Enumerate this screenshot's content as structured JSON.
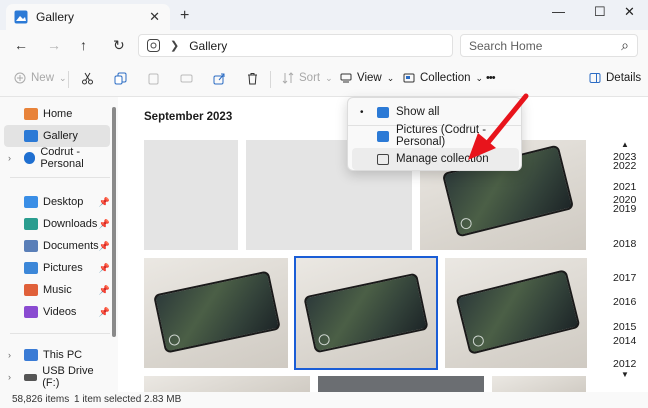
{
  "window": {
    "tab_title": "Gallery",
    "tab_close": "✕",
    "new_tab": "+",
    "minimize": "—",
    "maximize": "☐",
    "close": "✕"
  },
  "nav": {
    "back": "←",
    "forward": "→",
    "up": "↑",
    "refresh": "↻",
    "breadcrumb_sep": "❯",
    "breadcrumb": "Gallery",
    "search_placeholder": "Search Home",
    "search_icon": "⌕"
  },
  "toolbar": {
    "new_label": "New",
    "sort_label": "Sort",
    "view_label": "View",
    "collection_label": "Collection",
    "more": "•••",
    "details_label": "Details",
    "caret": "⌄"
  },
  "sidebar": {
    "items": [
      {
        "label": "Home",
        "icon": "home-icon",
        "color": "#e8833a"
      },
      {
        "label": "Gallery",
        "icon": "gallery-icon",
        "color": "#2c7ad6"
      },
      {
        "label": "Codrut - Personal",
        "icon": "onedrive-icon",
        "color": "#1f6fd0"
      },
      {
        "label": "Desktop",
        "icon": "desktop-icon",
        "color": "#3a8ee6"
      },
      {
        "label": "Downloads",
        "icon": "downloads-icon",
        "color": "#2a9d8f"
      },
      {
        "label": "Documents",
        "icon": "documents-icon",
        "color": "#5a7fb8"
      },
      {
        "label": "Pictures",
        "icon": "pictures-icon",
        "color": "#3c87d8"
      },
      {
        "label": "Music",
        "icon": "music-icon",
        "color": "#e0603a"
      },
      {
        "label": "Videos",
        "icon": "videos-icon",
        "color": "#8a4bd1"
      },
      {
        "label": "This PC",
        "icon": "pc-icon",
        "color": "#3a7bd5"
      },
      {
        "label": "USB Drive (F:)",
        "icon": "usb-drive-icon",
        "color": "#555555"
      }
    ],
    "pin": "📌",
    "chevron": "›"
  },
  "main": {
    "month_heading": "September 2023"
  },
  "menu": {
    "items": [
      {
        "label": "Show all",
        "bullet": "•"
      },
      {
        "label": "Pictures (Codrut - Personal)"
      },
      {
        "label": "Manage collection"
      }
    ]
  },
  "timeline": {
    "up": "▲",
    "down": "▼",
    "years": [
      "2023",
      "2022",
      "2021",
      "2020",
      "2019",
      "2018",
      "2017",
      "2016",
      "2015",
      "2014",
      "2012"
    ]
  },
  "status": {
    "item_count": "58,826 items",
    "selection": "1 item selected  2.83 MB"
  },
  "colors": {
    "accent": "#1a5dd6",
    "annotation_arrow": "#e8141c"
  }
}
